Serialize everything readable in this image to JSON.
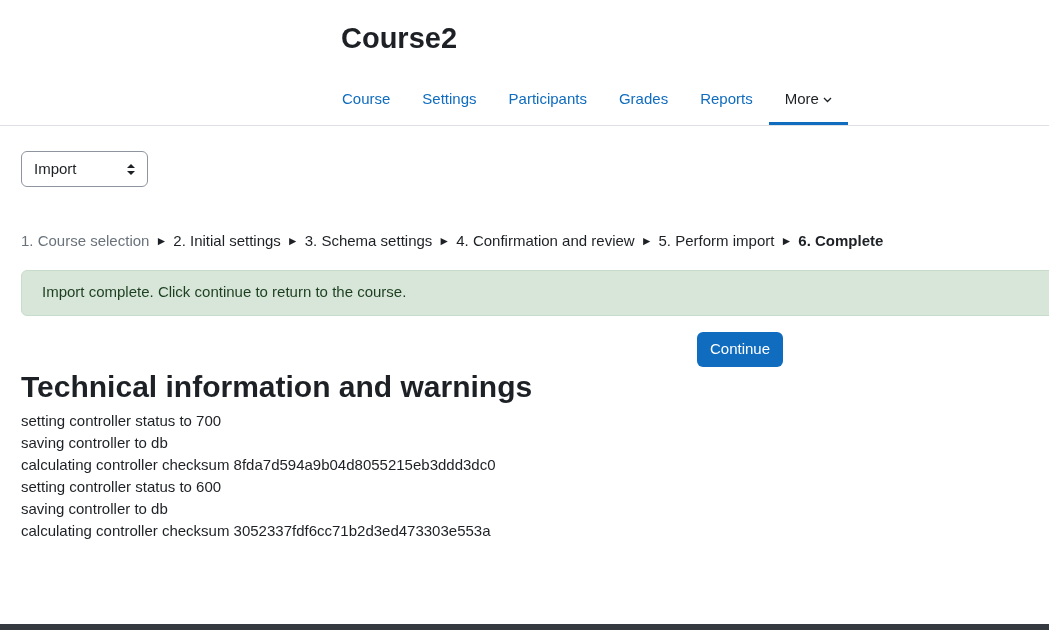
{
  "course_title": "Course2",
  "nav_tabs": [
    {
      "label": "Course",
      "selected": false,
      "kind": "link"
    },
    {
      "label": "Settings",
      "selected": false,
      "kind": "link"
    },
    {
      "label": "Participants",
      "selected": false,
      "kind": "link"
    },
    {
      "label": "Grades",
      "selected": false,
      "kind": "link"
    },
    {
      "label": "Reports",
      "selected": false,
      "kind": "link"
    },
    {
      "label": "More",
      "selected": true,
      "kind": "dropdown"
    }
  ],
  "action_select": {
    "value": "Import"
  },
  "breadcrumb": {
    "separator": "►",
    "steps": [
      {
        "label": "1. Course selection",
        "disabled": true,
        "selected": false
      },
      {
        "label": "2. Initial settings",
        "disabled": false,
        "selected": false
      },
      {
        "label": "3. Schema settings",
        "disabled": false,
        "selected": false
      },
      {
        "label": "4. Confirmation and review",
        "disabled": false,
        "selected": false
      },
      {
        "label": "5. Perform import",
        "disabled": false,
        "selected": false
      },
      {
        "label": "6. Complete",
        "disabled": false,
        "selected": true
      }
    ]
  },
  "alert": {
    "message": "Import complete. Click continue to return to the course."
  },
  "continue_button": "Continue",
  "technical_heading": "Technical information and warnings",
  "log_lines": [
    "setting controller status to 700",
    "saving controller to db",
    "calculating controller checksum 8fda7d594a9b04d8055215eb3ddd3dc0",
    "setting controller status to 600",
    "saving controller to db",
    "calculating controller checksum 3052337fdf6cc71b2d3ed473303e553a"
  ]
}
